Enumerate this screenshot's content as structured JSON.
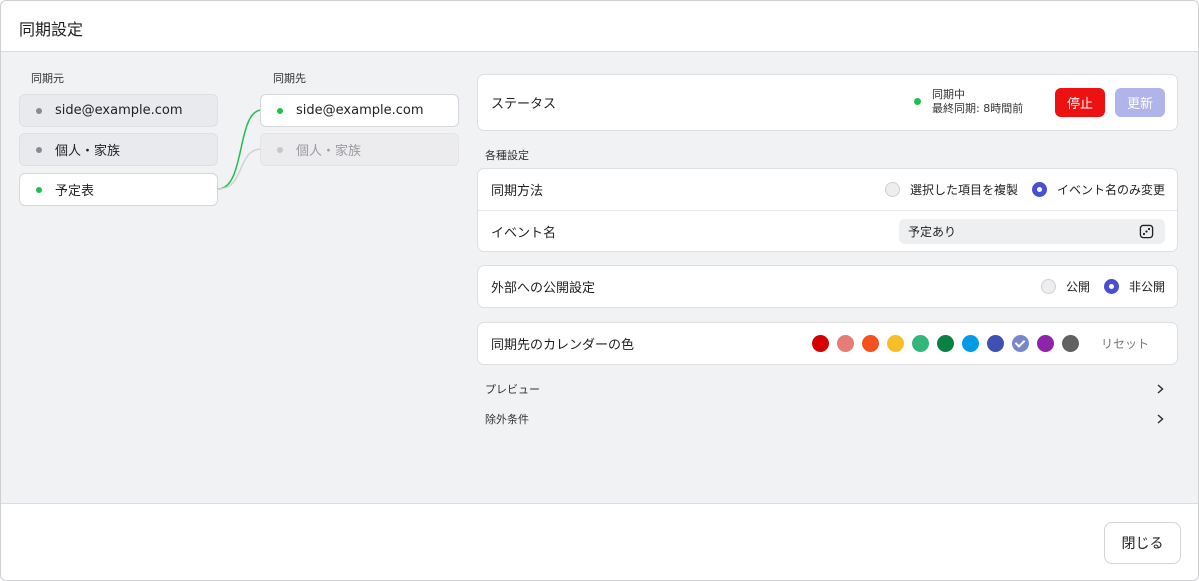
{
  "dialog": {
    "title": "同期設定",
    "close_label": "閉じる"
  },
  "source": {
    "label": "同期元",
    "items": [
      {
        "label": "side@example.com"
      },
      {
        "label": "個人・家族"
      },
      {
        "label": "予定表"
      }
    ]
  },
  "target": {
    "label": "同期先",
    "items": [
      {
        "label": "side@example.com"
      },
      {
        "label": "個人・家族"
      }
    ]
  },
  "status": {
    "label": "ステータス",
    "state": "同期中",
    "last_sync": "最終同期: 8時間前",
    "stop_label": "停止",
    "update_label": "更新"
  },
  "settings": {
    "section_label": "各種設定",
    "sync_method": {
      "label": "同期方法",
      "options": [
        "選択した項目を複製",
        "イベント名のみ変更"
      ],
      "selected": "イベント名のみ変更"
    },
    "event_name": {
      "label": "イベント名",
      "value": "予定あり",
      "icon": "dice-icon"
    }
  },
  "visibility": {
    "label": "外部への公開設定",
    "options": [
      "公開",
      "非公開"
    ],
    "selected": "非公開"
  },
  "color": {
    "label": "同期先のカレンダーの色",
    "swatches": [
      "#d50000",
      "#e67c73",
      "#f4511e",
      "#f6bf26",
      "#33b679",
      "#0b8043",
      "#039be5",
      "#3f51b5",
      "#7986cb",
      "#8e24aa",
      "#616161"
    ],
    "selected_index": 8,
    "reset_label": "リセット"
  },
  "expanders": [
    {
      "label": "プレビュー"
    },
    {
      "label": "除外条件"
    }
  ],
  "colors": {
    "accent": "#4a4fd0",
    "stop": "#ee1111",
    "update": "#b1b4ea",
    "active_dot": "#1fbf4f"
  }
}
